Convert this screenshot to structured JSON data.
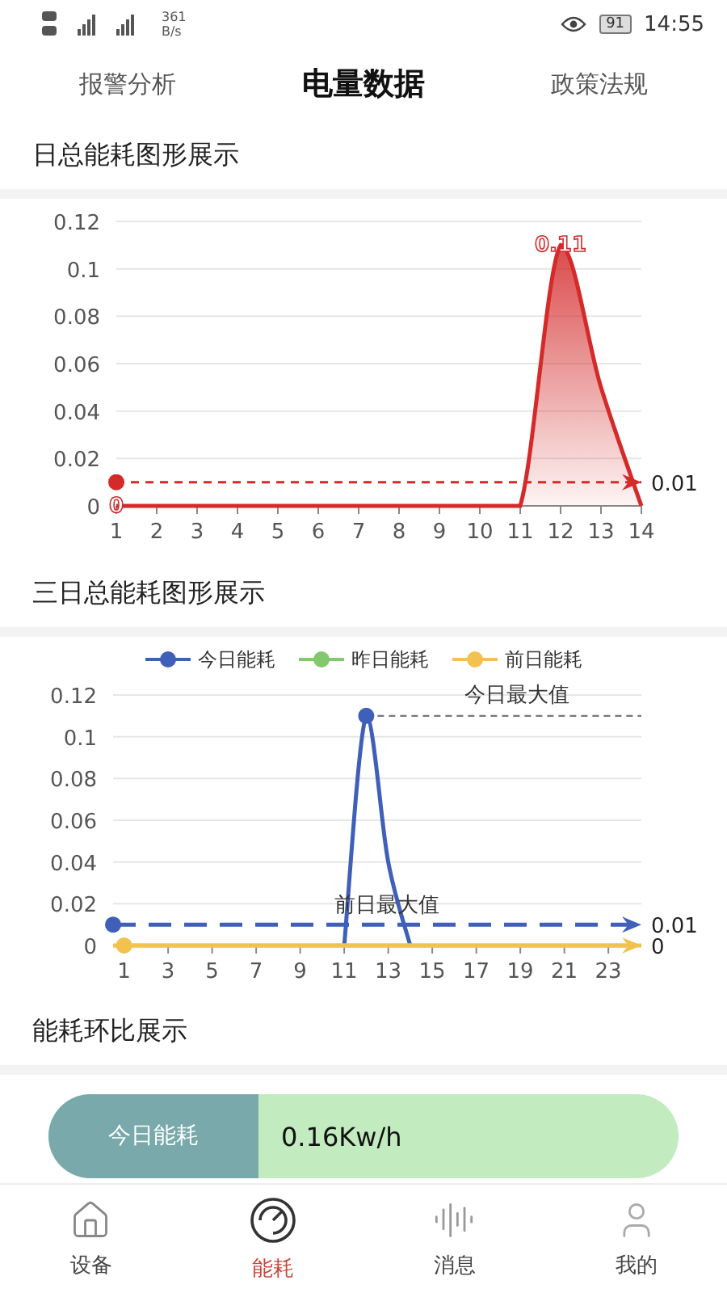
{
  "status_bar": {
    "speed_value": "361",
    "speed_unit": "B/s",
    "battery": "91",
    "time": "14:55"
  },
  "tabs": [
    {
      "label": "报警分析",
      "selected": false
    },
    {
      "label": "电量数据",
      "selected": true
    },
    {
      "label": "政策法规",
      "selected": false
    }
  ],
  "sections": [
    {
      "title": "日总能耗图形展示",
      "chart_data": {
        "type": "area",
        "x": [
          1,
          2,
          3,
          4,
          5,
          6,
          7,
          8,
          9,
          10,
          11,
          12,
          13,
          14
        ],
        "series": [
          {
            "color": "#d42a2a",
            "values": [
              0,
              0,
              0,
              0,
              0,
              0,
              0,
              0,
              0,
              0,
              0,
              0.11,
              0.05,
              0
            ]
          }
        ],
        "xlim": [
          1,
          14
        ],
        "ylim": [
          0,
          0.12
        ],
        "xticks": [
          1,
          2,
          3,
          4,
          5,
          6,
          7,
          8,
          9,
          10,
          11,
          12,
          13,
          14
        ],
        "yticks": [
          0,
          0.02,
          0.04,
          0.06,
          0.08,
          0.1,
          0.12
        ],
        "grid": true,
        "ref_lines": [
          {
            "axis": "y",
            "value": 0.01,
            "label": "0.01",
            "color": "#d42a2a"
          }
        ],
        "annotations": [
          {
            "text": "0.11",
            "x": 12,
            "y": 0.11
          },
          {
            "text": "0",
            "x": 1,
            "y": 0
          }
        ]
      }
    },
    {
      "title": "三日总能耗图形展示",
      "chart_data": {
        "type": "line",
        "x": [
          1,
          2,
          3,
          4,
          5,
          6,
          7,
          8,
          9,
          10,
          11,
          12,
          13,
          14,
          15,
          16,
          17,
          18,
          19,
          20,
          21,
          22,
          23,
          24
        ],
        "series": [
          {
            "name": "今日能耗",
            "color": "#3f5fb8",
            "values": [
              null,
              null,
              null,
              null,
              null,
              null,
              null,
              null,
              null,
              null,
              0,
              0.11,
              0.04,
              0,
              null,
              null,
              null,
              null,
              null,
              null,
              null,
              null,
              null,
              null
            ]
          },
          {
            "name": "昨日能耗",
            "color": "#82c86e",
            "values": [
              null,
              null,
              null,
              null,
              null,
              null,
              null,
              null,
              null,
              null,
              null,
              null,
              null,
              null,
              null,
              null,
              null,
              null,
              null,
              null,
              null,
              null,
              null,
              null
            ]
          },
          {
            "name": "前日能耗",
            "color": "#f2c14e",
            "values": [
              0,
              0,
              0,
              0,
              0,
              0,
              0,
              0,
              0,
              0,
              0,
              0,
              0,
              0,
              0,
              0,
              0,
              0,
              0,
              0,
              0,
              0,
              0,
              0
            ]
          }
        ],
        "xlim": [
          0.5,
          24.5
        ],
        "ylim": [
          0,
          0.12
        ],
        "xticks": [
          1,
          3,
          5,
          7,
          9,
          11,
          13,
          15,
          17,
          19,
          21,
          23
        ],
        "yticks": [
          0,
          0.02,
          0.04,
          0.06,
          0.08,
          0.1,
          0.12
        ],
        "grid": true,
        "legend": true,
        "ref_lines": [
          {
            "axis": "y",
            "value": 0.11,
            "label": "今日最大值",
            "color": "#777777"
          },
          {
            "axis": "y",
            "value": 0.01,
            "label": "0.01",
            "color": "#3f5fb8"
          },
          {
            "axis": "y",
            "value": 0,
            "label": "0",
            "color": "#f2c14e"
          }
        ],
        "annotations": [
          "前日最大值"
        ]
      }
    },
    {
      "title": "能耗环比展示",
      "comparison": {
        "label": "今日能耗",
        "value": "0.16Kw/h"
      }
    }
  ],
  "nav": [
    {
      "label": "设备",
      "selected": false
    },
    {
      "label": "能耗",
      "selected": true
    },
    {
      "label": "消息",
      "selected": false
    },
    {
      "label": "我的",
      "selected": false
    }
  ]
}
